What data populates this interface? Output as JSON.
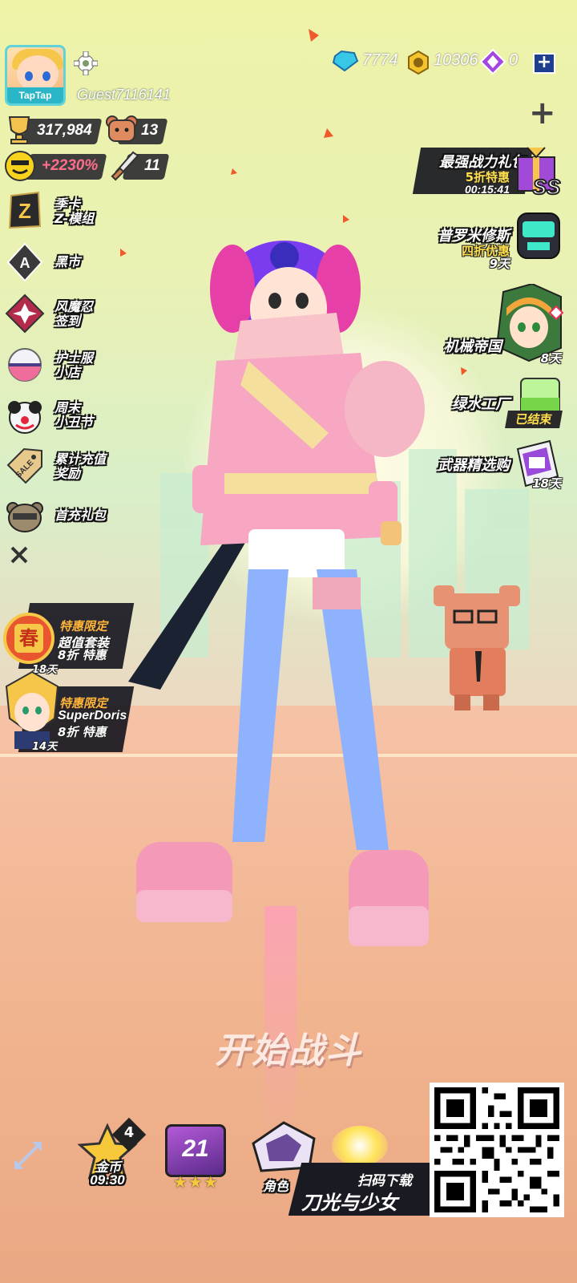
{
  "player": {
    "name": "Guest7116141",
    "platform_badge": "TapTap",
    "trophies": "317,984",
    "bear_count": "13",
    "rate_bonus": "+2230%",
    "sword_count": "11"
  },
  "currencies": {
    "diamonds": "7774",
    "coins": "10306",
    "purple": "0"
  },
  "left_menu": [
    {
      "label": "季卡\nZ-模组",
      "icon": "z-card-icon"
    },
    {
      "label": "黑市",
      "icon": "spade-card-icon"
    },
    {
      "label": "风魔忍\n签到",
      "icon": "ninja-star-icon"
    },
    {
      "label": "护士服\n小店",
      "icon": "capsule-icon"
    },
    {
      "label": "周末\n小丑节",
      "icon": "clown-icon"
    },
    {
      "label": "累计充值\n奖励",
      "icon": "sale-tag-icon"
    },
    {
      "label": "首充礼包",
      "icon": "bear-head-icon"
    }
  ],
  "left_promos": [
    {
      "title": "特惠限定",
      "line1": "超值套装",
      "line2": "8折 特惠",
      "days": "18天",
      "badge": "春"
    },
    {
      "title": "特惠限定",
      "line1": "SuperDoris",
      "line2": "8折 特惠",
      "days": "14天"
    }
  ],
  "right_events": [
    {
      "label": "最强战力礼包",
      "sub": "5折特惠",
      "timer": "00:15:41",
      "badge": "SS"
    },
    {
      "label": "普罗米修斯",
      "sub": "四折优惠",
      "days": "9天"
    },
    {
      "label": "机械帝国",
      "days": "8天"
    },
    {
      "label": "绿水工厂",
      "status": "已结束"
    },
    {
      "label": "武器精选购",
      "days": "18天"
    }
  ],
  "start_button": "开始战斗",
  "bottom_bar": {
    "coin_label": "金币",
    "coin_timer": "09:30",
    "coin_badge": "4",
    "level": "21",
    "role_label": "角色"
  },
  "download": {
    "scan_text": "扫码下载",
    "game_title": "刀光与少女"
  },
  "colors": {
    "accent_yellow": "#ffdf4b",
    "pink": "#f7a7c2",
    "cyan": "#5fd3d8"
  }
}
